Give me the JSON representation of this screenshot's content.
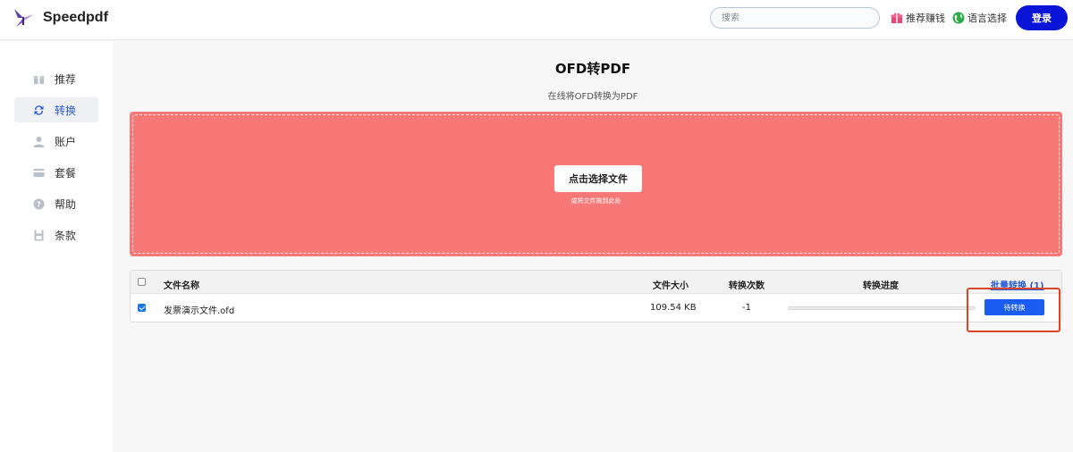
{
  "header": {
    "brand": "Speedpdf",
    "search_placeholder": "搜索",
    "referral_label": "推荐赚钱",
    "language_label": "语言选择",
    "login_label": "登录"
  },
  "sidebar": {
    "items": [
      {
        "label": "推荐",
        "icon": "gift-icon",
        "active": false
      },
      {
        "label": "转换",
        "icon": "convert-icon",
        "active": true
      },
      {
        "label": "账户",
        "icon": "user-icon",
        "active": false
      },
      {
        "label": "套餐",
        "icon": "card-icon",
        "active": false
      },
      {
        "label": "帮助",
        "icon": "help-icon",
        "active": false
      },
      {
        "label": "条款",
        "icon": "terms-icon",
        "active": false
      }
    ]
  },
  "main": {
    "title": "OFD转PDF",
    "subtitle": "在线将OFD转换为PDF",
    "upload": {
      "button_label": "点击选择文件",
      "hint": "或将文件拖到此处"
    },
    "table": {
      "headers": {
        "name": "文件名称",
        "size": "文件大小",
        "count": "转换次数",
        "progress": "转换进度",
        "batch": "批量转换 (1)"
      },
      "rows": [
        {
          "checked": true,
          "name": "发票演示文件.ofd",
          "size": "109.54 KB",
          "count": "-1",
          "progress": 0,
          "action": "待转换"
        }
      ],
      "select_all_checked": false
    }
  },
  "colors": {
    "accent": "#0a14d6",
    "dropzone": "#f77877",
    "convert_button": "#1a5cf0",
    "highlight": "#d9452a"
  }
}
